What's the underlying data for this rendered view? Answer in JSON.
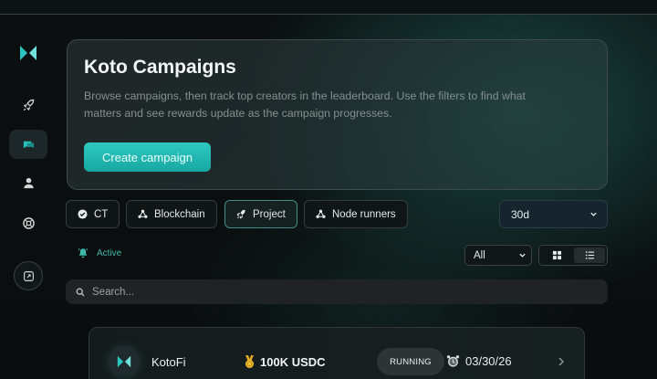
{
  "hero": {
    "title": "Koto Campaigns",
    "description": "Browse campaigns, then track top creators in the leaderboard. Use the filters to find what matters and see rewards update as the campaign progresses.",
    "cta_label": "Create campaign"
  },
  "sidebar": {
    "items": [
      {
        "icon": "logo-icon",
        "active": false
      },
      {
        "icon": "rocket-icon",
        "active": false
      },
      {
        "icon": "chat-icon",
        "active": true
      },
      {
        "icon": "user-icon",
        "active": false
      },
      {
        "icon": "help-icon",
        "active": false
      },
      {
        "icon": "expand-icon",
        "active": false
      }
    ]
  },
  "filters": {
    "categories": [
      {
        "label": "CT",
        "icon": "check-circle-icon",
        "selected": false
      },
      {
        "label": "Blockchain",
        "icon": "nodes-icon",
        "selected": false
      },
      {
        "label": "Project",
        "icon": "rocket-icon",
        "selected": true
      },
      {
        "label": "Node runners",
        "icon": "nodes-icon",
        "selected": false
      }
    ],
    "period": "30d",
    "status_tag": "Active",
    "status_select": "All",
    "view": "list"
  },
  "search": {
    "placeholder": "Search..."
  },
  "campaigns": [
    {
      "name": "KotoFi",
      "reward": "100K USDC",
      "status": "RUNNING",
      "end_date": "03/30/26"
    }
  ],
  "colors": {
    "accent": "#2fc9c2",
    "background": "#0b0f10",
    "active_tag": "#3fb8a9"
  }
}
